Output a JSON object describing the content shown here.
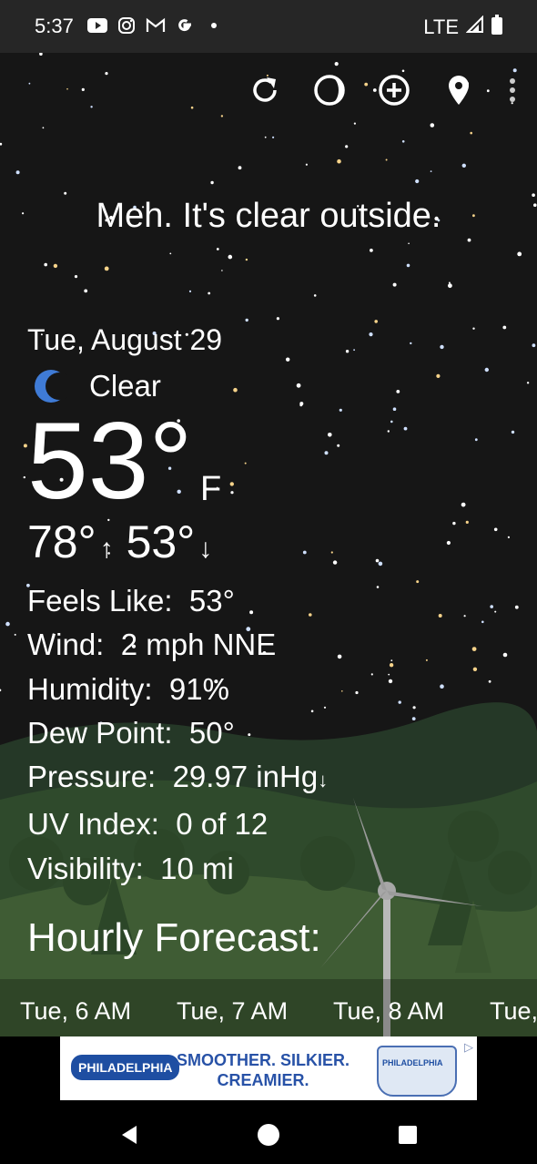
{
  "status_bar": {
    "time": "5:37",
    "notification_icons": [
      "youtube-icon",
      "instagram-icon",
      "gmail-icon",
      "google-icon",
      "dot-icon"
    ],
    "network": "LTE",
    "status_icons": [
      "signal-icon",
      "battery-icon"
    ]
  },
  "toolbar": {
    "icons": [
      "refresh-icon",
      "moon-phase-icon",
      "add-location-icon",
      "location-pin-icon",
      "overflow-menu-icon"
    ]
  },
  "weather": {
    "headline": "Meh. It's clear outside.",
    "date": "Tue, August 29",
    "condition": "Clear",
    "condition_icon": "crescent-moon-icon",
    "temperature": "53°",
    "unit": "F",
    "high": "78°",
    "low": "53°",
    "details": [
      {
        "label": "Feels Like:",
        "value": "53°"
      },
      {
        "label": "Wind:",
        "value": "2 mph NNE"
      },
      {
        "label": "Humidity:",
        "value": "91%"
      },
      {
        "label": "Dew Point:",
        "value": "50°"
      },
      {
        "label": "Pressure:",
        "value": "29.97 inHg",
        "trend": "falling"
      },
      {
        "label": "UV Index:",
        "value": "0 of 12"
      },
      {
        "label": "Visibility:",
        "value": "10 mi"
      }
    ]
  },
  "hourly": {
    "title": "Hourly Forecast:",
    "hours": [
      "Tue, 6 AM",
      "Tue, 7 AM",
      "Tue, 8 AM",
      "Tue,"
    ]
  },
  "ad": {
    "brand": "PHILADELPHIA",
    "tagline_line1": "SMOOTHER. SILKIER.",
    "tagline_line2": "CREAMIER.",
    "product_label": "PHILADELPHIA"
  },
  "navigation": {
    "icons": [
      "back-icon",
      "home-icon",
      "recents-icon"
    ]
  },
  "colors": {
    "night_sky": "#161616",
    "hills": "#3f5c34",
    "accent_moon": "#3f7bd6",
    "ad_blue": "#2852a7"
  }
}
